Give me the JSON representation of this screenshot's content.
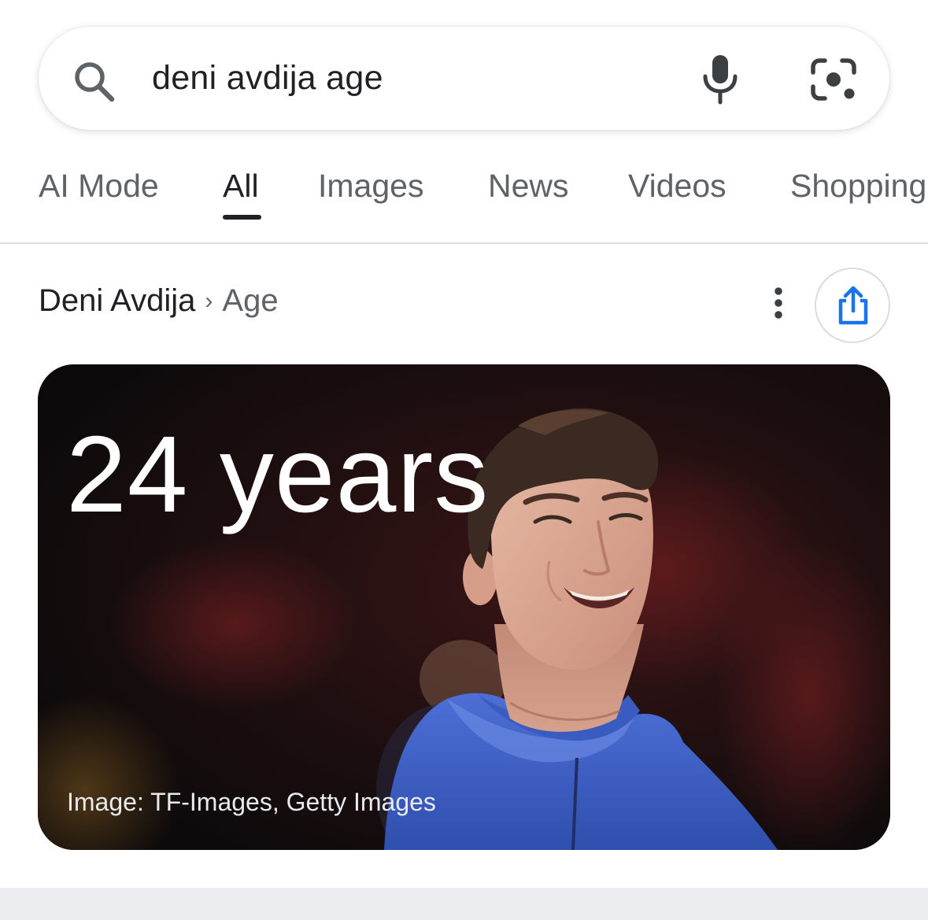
{
  "search": {
    "query": "deni avdija age",
    "icons": [
      "search-icon",
      "microphone-icon",
      "camera-lens-icon"
    ]
  },
  "tabs": [
    {
      "label": "AI Mode",
      "active": false
    },
    {
      "label": "All",
      "active": true
    },
    {
      "label": "Images",
      "active": false
    },
    {
      "label": "News",
      "active": false
    },
    {
      "label": "Videos",
      "active": false
    },
    {
      "label": "Shopping",
      "active": false
    }
  ],
  "breadcrumb": {
    "entity": "Deni Avdija",
    "separator": "›",
    "attribute": "Age"
  },
  "actions": {
    "more_icon": "vertical-dots-icon",
    "share_icon": "share-icon"
  },
  "answer": {
    "value": "24 years",
    "image_credit": "Image: TF-Images, Getty Images"
  },
  "colors": {
    "accent_blue": "#1a73e8",
    "text_primary": "#202124",
    "text_secondary": "#5f6368",
    "divider": "#dadce0",
    "jersey_blue": "#3d5fc4"
  }
}
